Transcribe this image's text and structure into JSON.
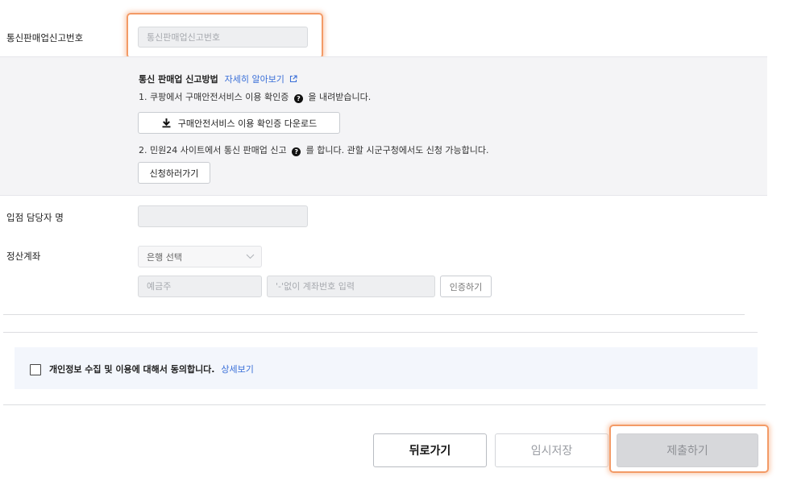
{
  "form": {
    "telecom_label": "통신판매업신고번호",
    "telecom_placeholder": "통신판매업신고번호",
    "manager_label": "입점 담당자 명",
    "settlement_label": "정산계좌"
  },
  "guide": {
    "title": "통신 판매업 신고방법",
    "learn_more": "자세히 알아보기",
    "step1_pre": "1. 쿠팡에서 구매안전서비스 이용 확인증",
    "step1_post": "을 내려받습니다.",
    "download_button": "구매안전서비스 이용 확인증 다운로드",
    "step2_pre": "2. 민원24 사이트에서 통신 판매업 신고",
    "step2_post": "를 합니다. 관할 시군구청에서도 신청 가능합니다.",
    "apply_button": "신청하러가기"
  },
  "account": {
    "bank_select": "은행 선택",
    "holder_placeholder": "예금주",
    "number_placeholder": "'-'없이 계좌번호 입력",
    "verify_button": "인증하기"
  },
  "agreement": {
    "text": "개인정보 수집 및 이용에 대해서 동의합니다.",
    "detail_link": "상세보기"
  },
  "footer": {
    "back_button": "뒤로가기",
    "temp_save_button": "임시저장",
    "submit_button": "제출하기"
  },
  "colors": {
    "link": "#3a6fd8",
    "highlight": "#f39a66",
    "submit_disabled": "#d7d8db"
  }
}
